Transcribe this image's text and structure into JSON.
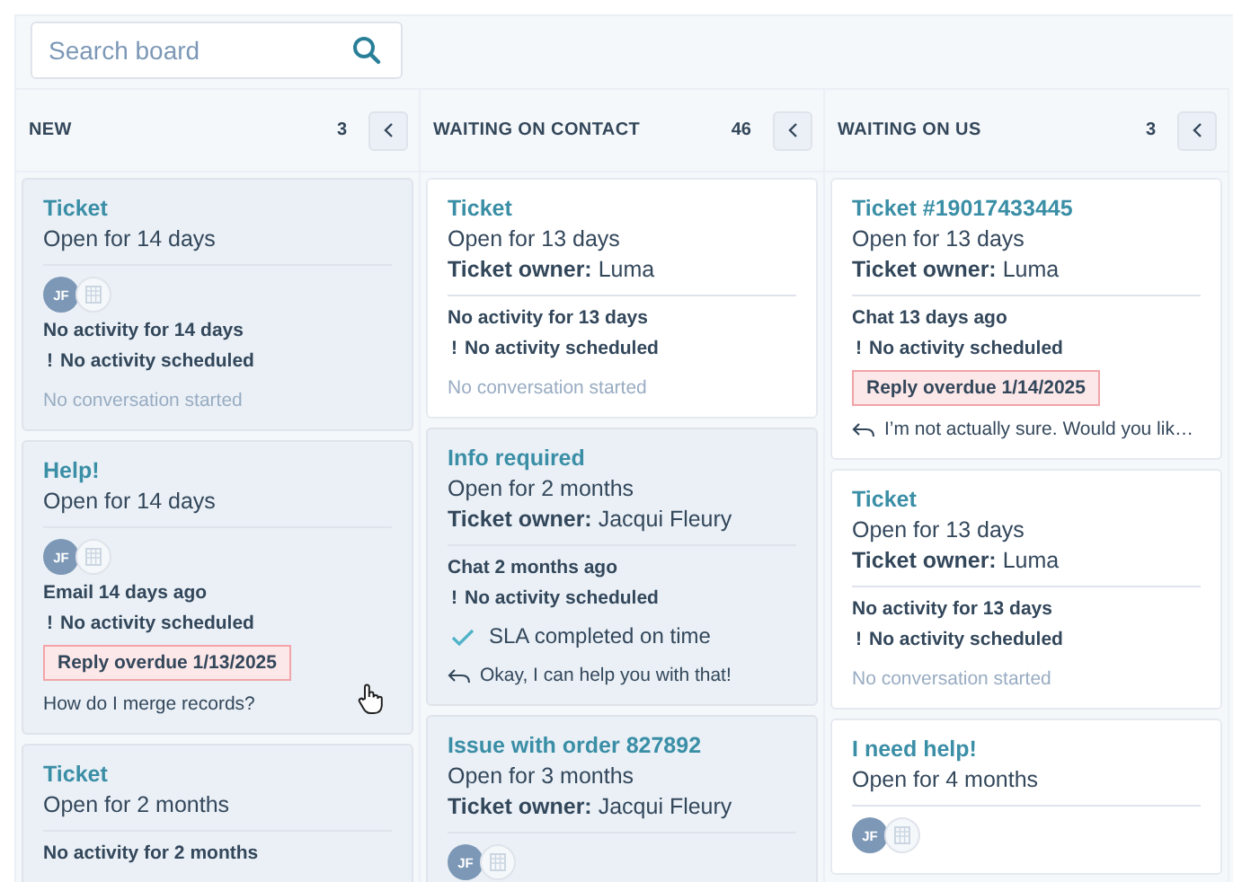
{
  "search": {
    "placeholder": "Search board"
  },
  "columns": [
    {
      "name": "NEW",
      "count": "3",
      "cards": [
        {
          "title": "Ticket",
          "highlighted": true,
          "open_for": "Open for 14 days",
          "avatar": "JF",
          "activity": "No activity for 14 days",
          "scheduled": {
            "mark": "!",
            "text": "No activity scheduled"
          },
          "message": {
            "kind": "none",
            "text": "No conversation started"
          }
        },
        {
          "title": "Help!",
          "highlighted": true,
          "cursor": true,
          "open_for": "Open for 14 days",
          "avatar": "JF",
          "activity": "Email 14 days ago",
          "scheduled": {
            "mark": "!",
            "text": "No activity scheduled"
          },
          "overdue": "Reply overdue 1/13/2025",
          "message": {
            "kind": "message",
            "text": "How do I merge records?"
          }
        },
        {
          "title": "Ticket",
          "highlighted": true,
          "open_for": "Open for 2 months",
          "activity": "No activity for 2 months"
        }
      ]
    },
    {
      "name": "WAITING ON CONTACT",
      "count": "46",
      "cards": [
        {
          "title": "Ticket",
          "highlighted": false,
          "open_for": "Open for 13 days",
          "owner": {
            "label": "Ticket owner:",
            "name": "Luma"
          },
          "activity": "No activity for 13 days",
          "scheduled": {
            "mark": "!",
            "text": "No activity scheduled"
          },
          "message": {
            "kind": "none",
            "text": "No conversation started"
          }
        },
        {
          "title": "Info required",
          "highlighted": true,
          "open_for": "Open for 2 months",
          "owner": {
            "label": "Ticket owner:",
            "name": "Jacqui Fleury"
          },
          "activity": "Chat 2 months ago",
          "scheduled": {
            "mark": "!",
            "text": "No activity scheduled"
          },
          "sla": "SLA completed on time",
          "message": {
            "kind": "reply",
            "text": "Okay, I can help you with that!"
          }
        },
        {
          "title": "Issue with order 827892",
          "highlighted": true,
          "open_for": "Open for 3 months",
          "owner": {
            "label": "Ticket owner:",
            "name": "Jacqui Fleury"
          },
          "avatar": "JF"
        }
      ]
    },
    {
      "name": "WAITING ON US",
      "count": "3",
      "cards": [
        {
          "title": "Ticket #19017433445",
          "highlighted": false,
          "open_for": "Open for 13 days",
          "owner": {
            "label": "Ticket owner:",
            "name": "Luma"
          },
          "activity": "Chat 13 days ago",
          "scheduled": {
            "mark": "!",
            "text": "No activity scheduled"
          },
          "overdue": "Reply overdue 1/14/2025",
          "message": {
            "kind": "reply",
            "text": "I’m not actually sure. Would you lik…"
          }
        },
        {
          "title": "Ticket",
          "highlighted": false,
          "open_for": "Open for 13 days",
          "owner": {
            "label": "Ticket owner:",
            "name": "Luma"
          },
          "activity": "No activity for 13 days",
          "scheduled": {
            "mark": "!",
            "text": "No activity scheduled"
          },
          "message": {
            "kind": "none",
            "text": "No conversation started"
          }
        },
        {
          "title": "I need help!",
          "highlighted": false,
          "open_for": "Open for 4 months",
          "avatar": "JF"
        }
      ]
    }
  ]
}
